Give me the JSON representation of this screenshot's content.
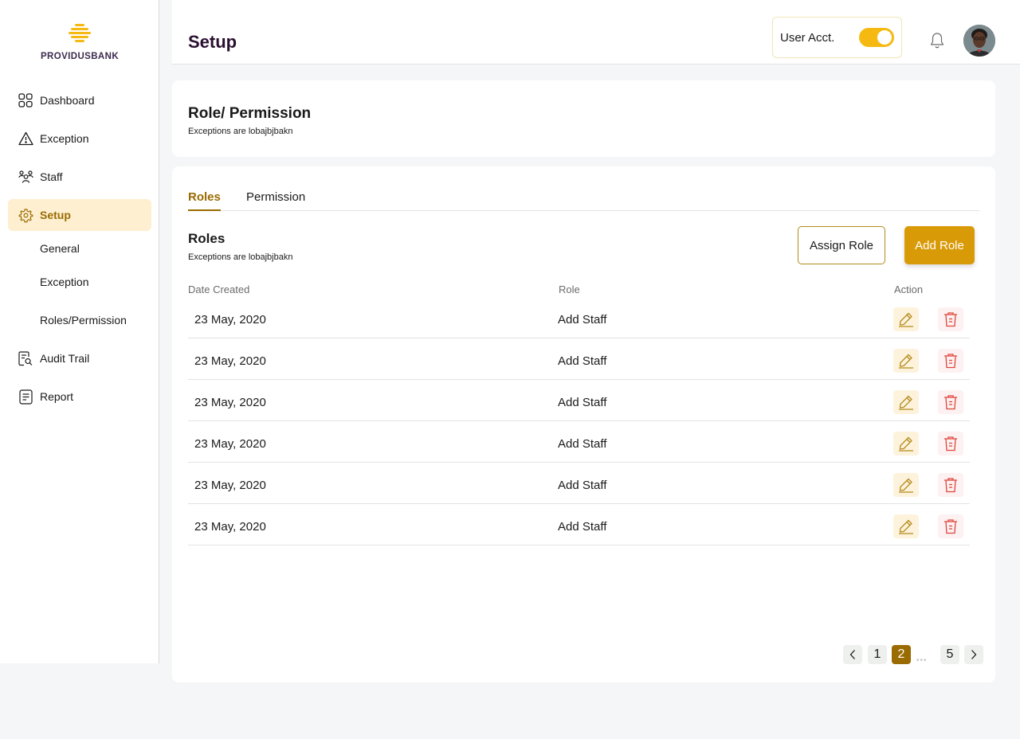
{
  "brand": {
    "name": "PROVIDUSBANK",
    "logo_color": "#f6b912"
  },
  "sidebar": {
    "items": [
      {
        "label": "Dashboard",
        "icon": "grid-icon"
      },
      {
        "label": "Exception",
        "icon": "warning-icon"
      },
      {
        "label": "Staff",
        "icon": "people-icon"
      },
      {
        "label": "Setup",
        "icon": "gear-icon",
        "active": true
      },
      {
        "label": "Audit Trail",
        "icon": "document-search-icon"
      },
      {
        "label": "Report",
        "icon": "report-icon"
      }
    ],
    "sub_items": [
      "General",
      "Exception",
      "Roles/Permission"
    ]
  },
  "header": {
    "title": "Setup",
    "account_label": "User Acct.",
    "account_toggle_on": true
  },
  "overview": {
    "title": "Role/ Permission",
    "subtitle": "Exceptions are lobajbjbakn"
  },
  "tabs": [
    {
      "label": "Roles",
      "active": true
    },
    {
      "label": "Permission",
      "active": false
    }
  ],
  "roles_section": {
    "title": "Roles",
    "subtitle": "Exceptions are lobajbjbakn",
    "assign_label": "Assign Role",
    "add_label": "Add Role"
  },
  "table": {
    "headers": {
      "date": "Date Created",
      "role": "Role",
      "action": "Action"
    },
    "rows": [
      {
        "date": "23 May, 2020",
        "role": "Add Staff"
      },
      {
        "date": "23 May, 2020",
        "role": "Add Staff"
      },
      {
        "date": "23 May, 2020",
        "role": "Add Staff"
      },
      {
        "date": "23 May, 2020",
        "role": "Add Staff"
      },
      {
        "date": "23 May, 2020",
        "role": "Add Staff"
      },
      {
        "date": "23 May, 2020",
        "role": "Add Staff"
      }
    ]
  },
  "pagination": {
    "first": "1",
    "current": "2",
    "last": "5",
    "ellipsis": "•••"
  },
  "colors": {
    "accent": "#9a6b00",
    "primary_button": "#d99a07",
    "delete": "#e0463c",
    "toggle": "#f6b912"
  }
}
